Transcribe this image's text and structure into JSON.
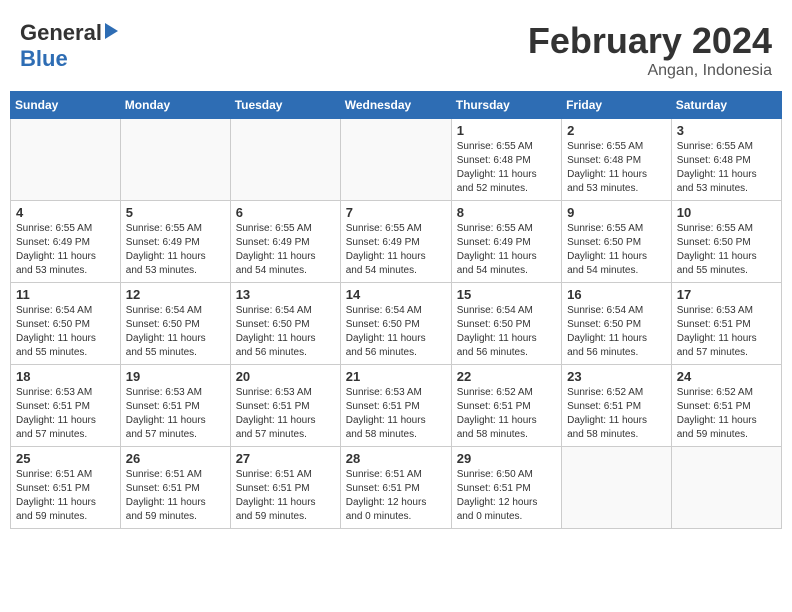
{
  "header": {
    "logo_general": "General",
    "logo_blue": "Blue",
    "month_title": "February 2024",
    "location": "Angan, Indonesia"
  },
  "weekdays": [
    "Sunday",
    "Monday",
    "Tuesday",
    "Wednesday",
    "Thursday",
    "Friday",
    "Saturday"
  ],
  "weeks": [
    [
      {
        "num": "",
        "info": ""
      },
      {
        "num": "",
        "info": ""
      },
      {
        "num": "",
        "info": ""
      },
      {
        "num": "",
        "info": ""
      },
      {
        "num": "1",
        "info": "Sunrise: 6:55 AM\nSunset: 6:48 PM\nDaylight: 11 hours\nand 52 minutes."
      },
      {
        "num": "2",
        "info": "Sunrise: 6:55 AM\nSunset: 6:48 PM\nDaylight: 11 hours\nand 53 minutes."
      },
      {
        "num": "3",
        "info": "Sunrise: 6:55 AM\nSunset: 6:48 PM\nDaylight: 11 hours\nand 53 minutes."
      }
    ],
    [
      {
        "num": "4",
        "info": "Sunrise: 6:55 AM\nSunset: 6:49 PM\nDaylight: 11 hours\nand 53 minutes."
      },
      {
        "num": "5",
        "info": "Sunrise: 6:55 AM\nSunset: 6:49 PM\nDaylight: 11 hours\nand 53 minutes."
      },
      {
        "num": "6",
        "info": "Sunrise: 6:55 AM\nSunset: 6:49 PM\nDaylight: 11 hours\nand 54 minutes."
      },
      {
        "num": "7",
        "info": "Sunrise: 6:55 AM\nSunset: 6:49 PM\nDaylight: 11 hours\nand 54 minutes."
      },
      {
        "num": "8",
        "info": "Sunrise: 6:55 AM\nSunset: 6:49 PM\nDaylight: 11 hours\nand 54 minutes."
      },
      {
        "num": "9",
        "info": "Sunrise: 6:55 AM\nSunset: 6:50 PM\nDaylight: 11 hours\nand 54 minutes."
      },
      {
        "num": "10",
        "info": "Sunrise: 6:55 AM\nSunset: 6:50 PM\nDaylight: 11 hours\nand 55 minutes."
      }
    ],
    [
      {
        "num": "11",
        "info": "Sunrise: 6:54 AM\nSunset: 6:50 PM\nDaylight: 11 hours\nand 55 minutes."
      },
      {
        "num": "12",
        "info": "Sunrise: 6:54 AM\nSunset: 6:50 PM\nDaylight: 11 hours\nand 55 minutes."
      },
      {
        "num": "13",
        "info": "Sunrise: 6:54 AM\nSunset: 6:50 PM\nDaylight: 11 hours\nand 56 minutes."
      },
      {
        "num": "14",
        "info": "Sunrise: 6:54 AM\nSunset: 6:50 PM\nDaylight: 11 hours\nand 56 minutes."
      },
      {
        "num": "15",
        "info": "Sunrise: 6:54 AM\nSunset: 6:50 PM\nDaylight: 11 hours\nand 56 minutes."
      },
      {
        "num": "16",
        "info": "Sunrise: 6:54 AM\nSunset: 6:50 PM\nDaylight: 11 hours\nand 56 minutes."
      },
      {
        "num": "17",
        "info": "Sunrise: 6:53 AM\nSunset: 6:51 PM\nDaylight: 11 hours\nand 57 minutes."
      }
    ],
    [
      {
        "num": "18",
        "info": "Sunrise: 6:53 AM\nSunset: 6:51 PM\nDaylight: 11 hours\nand 57 minutes."
      },
      {
        "num": "19",
        "info": "Sunrise: 6:53 AM\nSunset: 6:51 PM\nDaylight: 11 hours\nand 57 minutes."
      },
      {
        "num": "20",
        "info": "Sunrise: 6:53 AM\nSunset: 6:51 PM\nDaylight: 11 hours\nand 57 minutes."
      },
      {
        "num": "21",
        "info": "Sunrise: 6:53 AM\nSunset: 6:51 PM\nDaylight: 11 hours\nand 58 minutes."
      },
      {
        "num": "22",
        "info": "Sunrise: 6:52 AM\nSunset: 6:51 PM\nDaylight: 11 hours\nand 58 minutes."
      },
      {
        "num": "23",
        "info": "Sunrise: 6:52 AM\nSunset: 6:51 PM\nDaylight: 11 hours\nand 58 minutes."
      },
      {
        "num": "24",
        "info": "Sunrise: 6:52 AM\nSunset: 6:51 PM\nDaylight: 11 hours\nand 59 minutes."
      }
    ],
    [
      {
        "num": "25",
        "info": "Sunrise: 6:51 AM\nSunset: 6:51 PM\nDaylight: 11 hours\nand 59 minutes."
      },
      {
        "num": "26",
        "info": "Sunrise: 6:51 AM\nSunset: 6:51 PM\nDaylight: 11 hours\nand 59 minutes."
      },
      {
        "num": "27",
        "info": "Sunrise: 6:51 AM\nSunset: 6:51 PM\nDaylight: 11 hours\nand 59 minutes."
      },
      {
        "num": "28",
        "info": "Sunrise: 6:51 AM\nSunset: 6:51 PM\nDaylight: 12 hours\nand 0 minutes."
      },
      {
        "num": "29",
        "info": "Sunrise: 6:50 AM\nSunset: 6:51 PM\nDaylight: 12 hours\nand 0 minutes."
      },
      {
        "num": "",
        "info": ""
      },
      {
        "num": "",
        "info": ""
      }
    ]
  ]
}
